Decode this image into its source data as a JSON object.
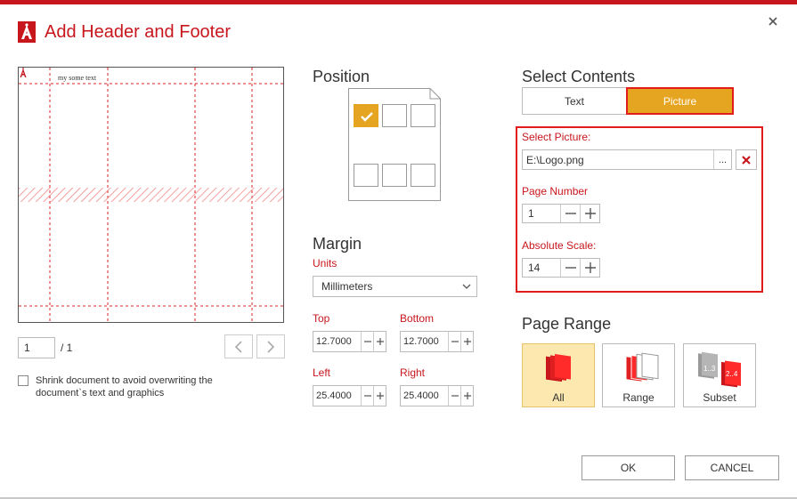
{
  "dialog": {
    "title": "Add Header and Footer",
    "brand_color": "#c8161d",
    "accent_color": "#e6a520"
  },
  "preview": {
    "sample_text": "my some text",
    "page_input": "1",
    "page_total": "/ 1"
  },
  "shrink": {
    "label": "Shrink document to avoid overwriting the document`s text and graphics",
    "checked": false
  },
  "position": {
    "heading": "Position",
    "selected_cell": "top-left"
  },
  "margin": {
    "heading": "Margin",
    "units_label": "Units",
    "units_value": "Millimeters",
    "top_label": "Top",
    "top_value": "12.7000",
    "bottom_label": "Bottom",
    "bottom_value": "12.7000",
    "left_label": "Left",
    "left_value": "25.4000",
    "right_label": "Right",
    "right_value": "25.4000"
  },
  "contents": {
    "heading": "Select Contents",
    "tab_text": "Text",
    "tab_picture": "Picture",
    "active_tab": "Picture",
    "select_picture_label": "Select Picture:",
    "picture_path": "E:\\Logo.png",
    "browse_label": "...",
    "page_number_label": "Page Number",
    "page_number_value": "1",
    "scale_label": "Absolute Scale:",
    "scale_value": "14"
  },
  "page_range": {
    "heading": "Page Range",
    "all_label": "All",
    "range_label": "Range",
    "subset_label": "Subset",
    "selected": "All"
  },
  "footer": {
    "ok_label": "OK",
    "cancel_label": "CANCEL"
  }
}
